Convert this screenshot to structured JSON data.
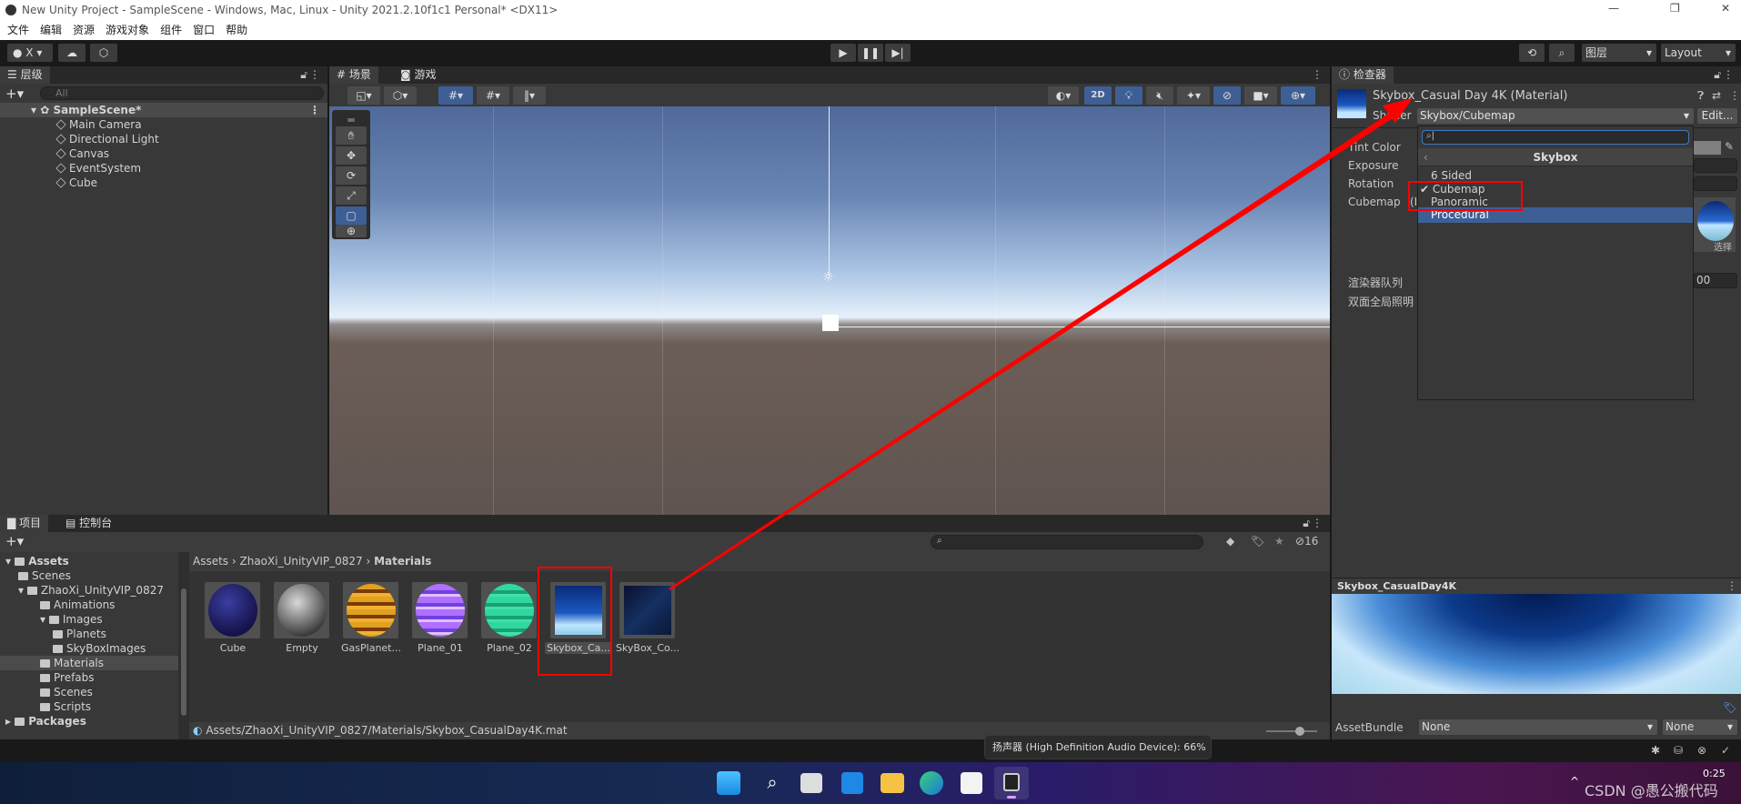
{
  "window": {
    "title": "New Unity Project - SampleScene - Windows, Mac, Linux - Unity 2021.2.10f1c1 Personal* <DX11>"
  },
  "menu": [
    "文件",
    "编辑",
    "资源",
    "游戏对象",
    "组件",
    "窗口",
    "帮助"
  ],
  "toolbar": {
    "account": "X",
    "layers": "图层",
    "layout": "Layout"
  },
  "hierarchy": {
    "tab": "层级",
    "search_placeholder": "All",
    "scene": "SampleScene*",
    "items": [
      "Main Camera",
      "Directional Light",
      "Canvas",
      "EventSystem",
      "Cube"
    ]
  },
  "scene": {
    "tabs": [
      "场景",
      "游戏"
    ],
    "mode_2d": "2D"
  },
  "inspector": {
    "tab": "检查器",
    "title": "Skybox_Casual Day 4K (Material)",
    "shader_label": "Shader",
    "shader_value": "Skybox/Cubemap",
    "edit_button": "Edit...",
    "properties": [
      "Tint Color",
      "Exposure",
      "Rotation",
      "Cubemap"
    ],
    "cubemap_prefix": "(I",
    "select_label": "选择",
    "render_queue_label": "渲染器队列",
    "render_queue_value": "00",
    "double_sided_gi_label": "双面全局照明",
    "dropdown": {
      "header": "Skybox",
      "items": [
        "6 Sided",
        "Cubemap",
        "Panoramic",
        "Procedural"
      ],
      "checked": "Cubemap",
      "highlighted": "Procedural"
    },
    "preview_title": "Skybox_CasualDay4K",
    "assetbundle_label": "AssetBundle",
    "assetbundle_value": "None",
    "assetbundle_variant": "None"
  },
  "project": {
    "tabs": [
      "项目",
      "控制台"
    ],
    "tree": [
      {
        "label": "Assets",
        "depth": 0,
        "bold": true
      },
      {
        "label": "Scenes",
        "depth": 1
      },
      {
        "label": "ZhaoXi_UnityVIP_0827",
        "depth": 1
      },
      {
        "label": "Animations",
        "depth": 2
      },
      {
        "label": "Images",
        "depth": 2
      },
      {
        "label": "Planets",
        "depth": 3
      },
      {
        "label": "SkyBoxImages",
        "depth": 3
      },
      {
        "label": "Materials",
        "depth": 2,
        "selected": true
      },
      {
        "label": "Prefabs",
        "depth": 2
      },
      {
        "label": "Scenes",
        "depth": 2
      },
      {
        "label": "Scripts",
        "depth": 2
      },
      {
        "label": "Packages",
        "depth": 0,
        "bold": true
      }
    ],
    "breadcrumb": [
      "Assets",
      "ZhaoXi_UnityVIP_0827",
      "Materials"
    ],
    "hidden_count": "16",
    "assets": [
      {
        "label": "Cube",
        "color": "radial-gradient(circle at 40% 35%,#3a3ea0,#16124a 70%)"
      },
      {
        "label": "Empty",
        "color": "radial-gradient(circle at 40% 35%,#d8d8d8,#3a3a3a 75%)"
      },
      {
        "label": "GasPlanet...",
        "color": "repeating-linear-gradient(#e0a020 0 6px,#7a3a08 6px 10px,#f0b030 10px 14px)"
      },
      {
        "label": "Plane_01",
        "color": "repeating-linear-gradient(#b070ff 0 7px,#7040e0 7px 11px,#e0c0ff 11px 14px)"
      },
      {
        "label": "Plane_02",
        "color": "repeating-linear-gradient(#30d8a0 0 7px,#18a070 7px 11px,#40e0b0 11px 14px)"
      },
      {
        "label": "Skybox_Ca...",
        "color": "linear-gradient(#0a2a78,#1a58c0 55%,#bfe6ff 80%,#8ccbe8)"
      },
      {
        "label": "SkyBox_Co...",
        "color": "linear-gradient(135deg,#0a1030,#143060 50%,#0a1838)"
      }
    ],
    "selected_asset": "Skybox_Ca...",
    "path": "Assets/ZhaoXi_UnityVIP_0827/Materials/Skybox_CasualDay4K.mat"
  },
  "tooltip": "扬声器 (High Definition Audio Device): 66%",
  "taskbar": {
    "time": "0:25",
    "watermark": "CSDN @愚公搬代码"
  },
  "colors": {
    "highlight": "#3e5f96",
    "annotation": "#ff0000",
    "panel": "#383838"
  }
}
